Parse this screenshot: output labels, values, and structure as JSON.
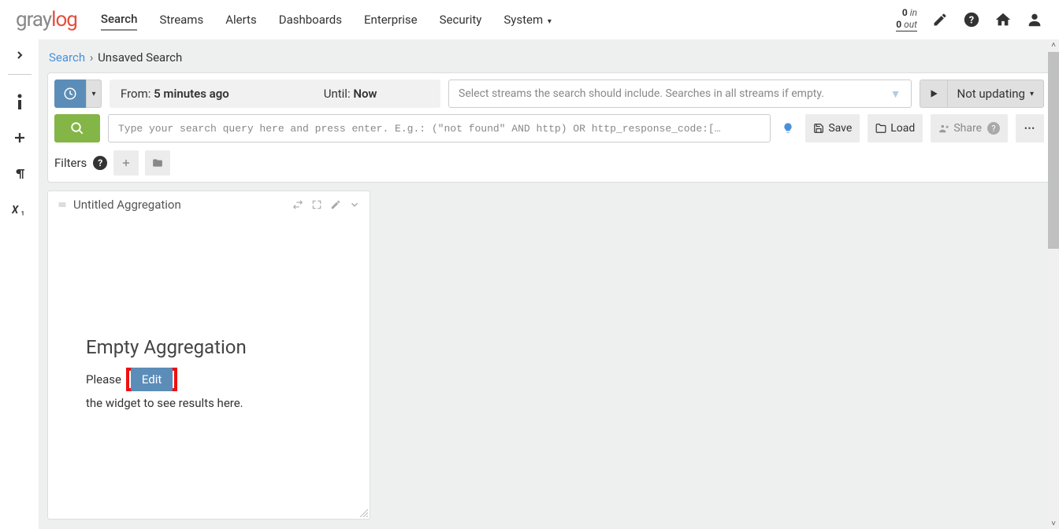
{
  "logo": {
    "gray": "gray",
    "red": "log"
  },
  "nav": [
    "Search",
    "Streams",
    "Alerts",
    "Dashboards",
    "Enterprise",
    "Security",
    "System"
  ],
  "io": {
    "in_n": "0",
    "in_lbl": "in",
    "out_n": "0",
    "out_lbl": "out"
  },
  "breadcrumb": {
    "link": "Search",
    "sep": "›",
    "current": "Unsaved Search"
  },
  "timerange": {
    "from_lbl": "From:",
    "from_val": "5 minutes ago",
    "until_lbl": "Until:",
    "until_val": "Now"
  },
  "streams_placeholder": "Select streams the search should include. Searches in all streams if empty.",
  "refresh": "Not updating",
  "query_placeholder": "Type your search query here and press enter. E.g.: (\"not found\" AND http) OR http_response_code:[…",
  "actions": {
    "save": "Save",
    "load": "Load",
    "share": "Share"
  },
  "filters_label": "Filters",
  "widget": {
    "title": "Untitled Aggregation",
    "empty_title": "Empty Aggregation",
    "text_before": "Please",
    "edit": "Edit",
    "text_after": "the widget to see results here."
  }
}
